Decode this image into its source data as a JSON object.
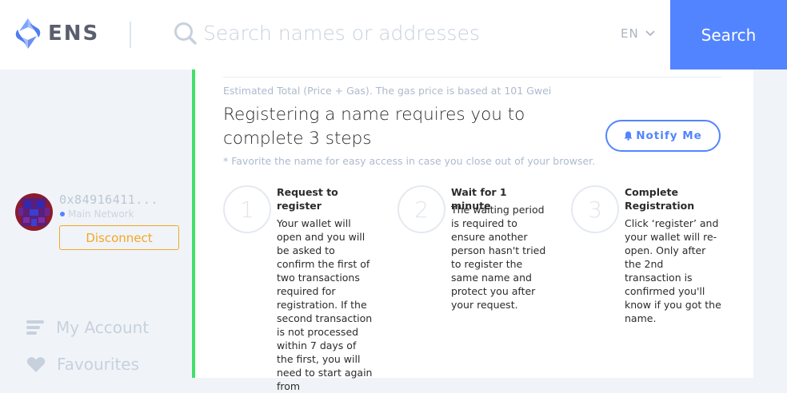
{
  "header": {
    "logo_text": "ENS",
    "search_placeholder": "Search names or addresses",
    "language": "EN",
    "search_button": "Search"
  },
  "account": {
    "address": "0x84916411...",
    "network": "Main Network",
    "disconnect_label": "Disconnect"
  },
  "nav": {
    "items": [
      {
        "label": "My Account",
        "icon": "list-icon"
      },
      {
        "label": "Favourites",
        "icon": "heart-icon"
      }
    ]
  },
  "registration": {
    "estimate_note": "Estimated Total (Price + Gas). The gas price is based at 101 Gwei",
    "heading": "Registering a name requires you to complete 3 steps",
    "notify_label": "Notify Me",
    "favorite_note": "* Favorite the name for easy access in case you close out of your browser.",
    "steps": [
      {
        "number": "1",
        "title": "Request to register",
        "text": "Your wallet will open and you will be asked to confirm the first of two transactions required for registration. If the second transaction is not processed within 7 days of the first, you will need to start again from"
      },
      {
        "number": "2",
        "title": "Wait for 1 minute",
        "text": "The waiting period is required to ensure another person hasn't tried to register the same name and protect you after your request."
      },
      {
        "number": "3",
        "title": "Complete Registration",
        "text": "Click ‘register’ and your wallet will re-open. Only after the 2nd transaction is confirmed you'll know if you got the name."
      }
    ]
  },
  "colors": {
    "accent": "#5284ff",
    "warning": "#f5a623",
    "success": "#42e068"
  }
}
